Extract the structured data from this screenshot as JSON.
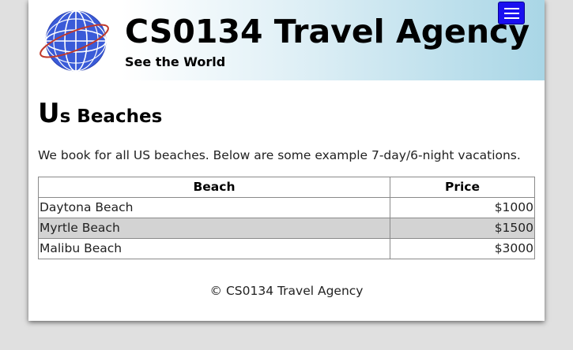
{
  "header": {
    "title": "CS0134 Travel Agency",
    "tagline": "See the World",
    "logo_icon": "globe-icon",
    "menu_icon": "hamburger-menu-icon",
    "menu_button_color": "#1a10f0"
  },
  "main": {
    "heading_first": "U",
    "heading_rest": "s Beaches",
    "intro": "We book for all US beaches. Below are some example 7-day/6-night vacations.",
    "table": {
      "columns": [
        "Beach",
        "Price"
      ],
      "rows": [
        {
          "beach": "Daytona Beach",
          "price": "$1000"
        },
        {
          "beach": "Myrtle Beach",
          "price": "$1500"
        },
        {
          "beach": "Malibu Beach",
          "price": "$3000"
        }
      ],
      "stripe_color": "#d3d3d3"
    }
  },
  "footer": {
    "text": "© CS0134 Travel Agency"
  }
}
